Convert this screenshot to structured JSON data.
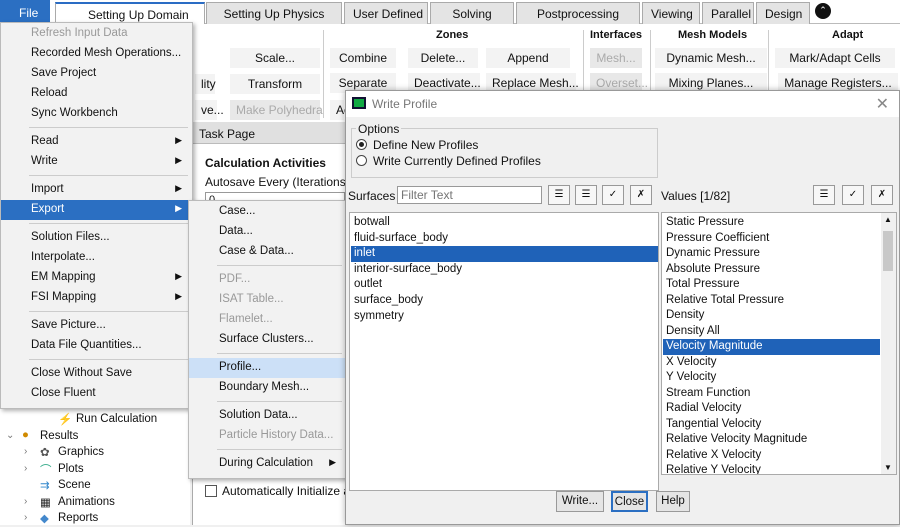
{
  "tabs": [
    "File",
    "Setting Up Domain",
    "Setting Up Physics",
    "User Defined",
    "Solving",
    "Postprocessing",
    "Viewing",
    "Parallel",
    "Design"
  ],
  "ribbon": {
    "groups": [
      "Zones",
      "Interfaces",
      "Mesh Models",
      "Adapt"
    ],
    "buttons": [
      {
        "label": "Scale...",
        "disabled": false
      },
      {
        "label": "Transform",
        "disabled": false
      },
      {
        "label": "Make Polyhedra",
        "disabled": true
      },
      {
        "label": "Combine",
        "disabled": false
      },
      {
        "label": "Separate",
        "disabled": false
      },
      {
        "label": "Ac",
        "disabled": false
      },
      {
        "label": "Delete...",
        "disabled": false
      },
      {
        "label": "Deactivate...",
        "disabled": false
      },
      {
        "label": "Append",
        "disabled": false
      },
      {
        "label": "Replace Mesh...",
        "disabled": false
      },
      {
        "label": "Mesh...",
        "disabled": true
      },
      {
        "label": "Overset...",
        "disabled": true
      },
      {
        "label": "Dynamic Mesh...",
        "disabled": false
      },
      {
        "label": "Mixing Planes...",
        "disabled": false
      },
      {
        "label": "Mark/Adapt Cells",
        "disabled": false
      },
      {
        "label": "Manage Registers...",
        "disabled": false
      },
      {
        "label": "lity",
        "disabled": false
      },
      {
        "label": "ve...",
        "disabled": false
      }
    ]
  },
  "file_menu": [
    {
      "label": "Refresh Input Data",
      "disabled": true
    },
    {
      "label": "Recorded Mesh Operations..."
    },
    {
      "label": "Save Project"
    },
    {
      "label": "Reload"
    },
    {
      "label": "Sync Workbench"
    },
    {
      "sep": true
    },
    {
      "label": "Read",
      "sub": true
    },
    {
      "label": "Write",
      "sub": true
    },
    {
      "sep": true
    },
    {
      "label": "Import",
      "sub": true
    },
    {
      "label": "Export",
      "sub": true,
      "highlight": true
    },
    {
      "sep": true
    },
    {
      "label": "Solution Files..."
    },
    {
      "label": "Interpolate..."
    },
    {
      "label": "EM Mapping",
      "sub": true
    },
    {
      "label": "FSI Mapping",
      "sub": true
    },
    {
      "sep": true
    },
    {
      "label": "Save Picture..."
    },
    {
      "label": "Data File Quantities..."
    },
    {
      "sep": true
    },
    {
      "label": "Close Without Save"
    },
    {
      "label": "Close Fluent"
    }
  ],
  "export_menu": [
    {
      "label": "Case..."
    },
    {
      "label": "Data..."
    },
    {
      "label": "Case & Data..."
    },
    {
      "sep": true
    },
    {
      "label": "PDF...",
      "disabled": true
    },
    {
      "label": "ISAT Table...",
      "disabled": true
    },
    {
      "label": "Flamelet...",
      "disabled": true
    },
    {
      "label": "Surface Clusters..."
    },
    {
      "sep": true
    },
    {
      "label": "Profile...",
      "highlight": true
    },
    {
      "label": "Boundary Mesh..."
    },
    {
      "sep": true
    },
    {
      "label": "Solution Data..."
    },
    {
      "label": "Particle History Data...",
      "disabled": true
    },
    {
      "sep": true
    },
    {
      "label": "During Calculation",
      "sub": true
    }
  ],
  "tree": [
    {
      "label": "Run Calculation",
      "level": 2,
      "icon": "lightning-icon"
    },
    {
      "label": "Results",
      "level": 0,
      "icon": "results-icon",
      "expanded": true
    },
    {
      "label": "Graphics",
      "level": 1,
      "icon": "graphics-icon",
      "expander": true
    },
    {
      "label": "Plots",
      "level": 1,
      "icon": "plots-icon",
      "expander": true
    },
    {
      "label": "Scene",
      "level": 1,
      "icon": "scene-icon"
    },
    {
      "label": "Animations",
      "level": 1,
      "icon": "film-icon",
      "expander": true
    },
    {
      "label": "Reports",
      "level": 1,
      "icon": "reports-icon",
      "expander": true
    }
  ],
  "task_page": {
    "header": "Task Page",
    "title": "Calculation Activities",
    "autosave_label": "Autosave Every (Iterations)",
    "autosave_value": "0",
    "auto_init": "Automatically Initialize an"
  },
  "dialog": {
    "title": "Write Profile",
    "options_label": "Options",
    "options": [
      {
        "label": "Define New Profiles",
        "checked": true
      },
      {
        "label": "Write Currently Defined Profiles",
        "checked": false
      }
    ],
    "surfaces_label": "Surfaces",
    "filter_placeholder": "Filter Text",
    "values_label": "Values [1/82]",
    "surfaces": [
      "botwall",
      "fluid-surface_body",
      "inlet",
      "interior-surface_body",
      "outlet",
      "surface_body",
      "symmetry"
    ],
    "selected_surface": "inlet",
    "values": [
      "Static Pressure",
      "Pressure Coefficient",
      "Dynamic Pressure",
      "Absolute Pressure",
      "Total Pressure",
      "Relative Total Pressure",
      "Density",
      "Density All",
      "Velocity Magnitude",
      "X Velocity",
      "Y Velocity",
      "Stream Function",
      "Radial Velocity",
      "Tangential Velocity",
      "Relative Velocity Magnitude",
      "Relative X Velocity",
      "Relative Y Velocity"
    ],
    "selected_value": "Velocity Magnitude",
    "buttons": {
      "write": "Write...",
      "close": "Close",
      "help": "Help"
    }
  },
  "colors": {
    "accent": "#2b6fc2",
    "selection": "#1f62b8",
    "hover": "#cce0f7"
  }
}
